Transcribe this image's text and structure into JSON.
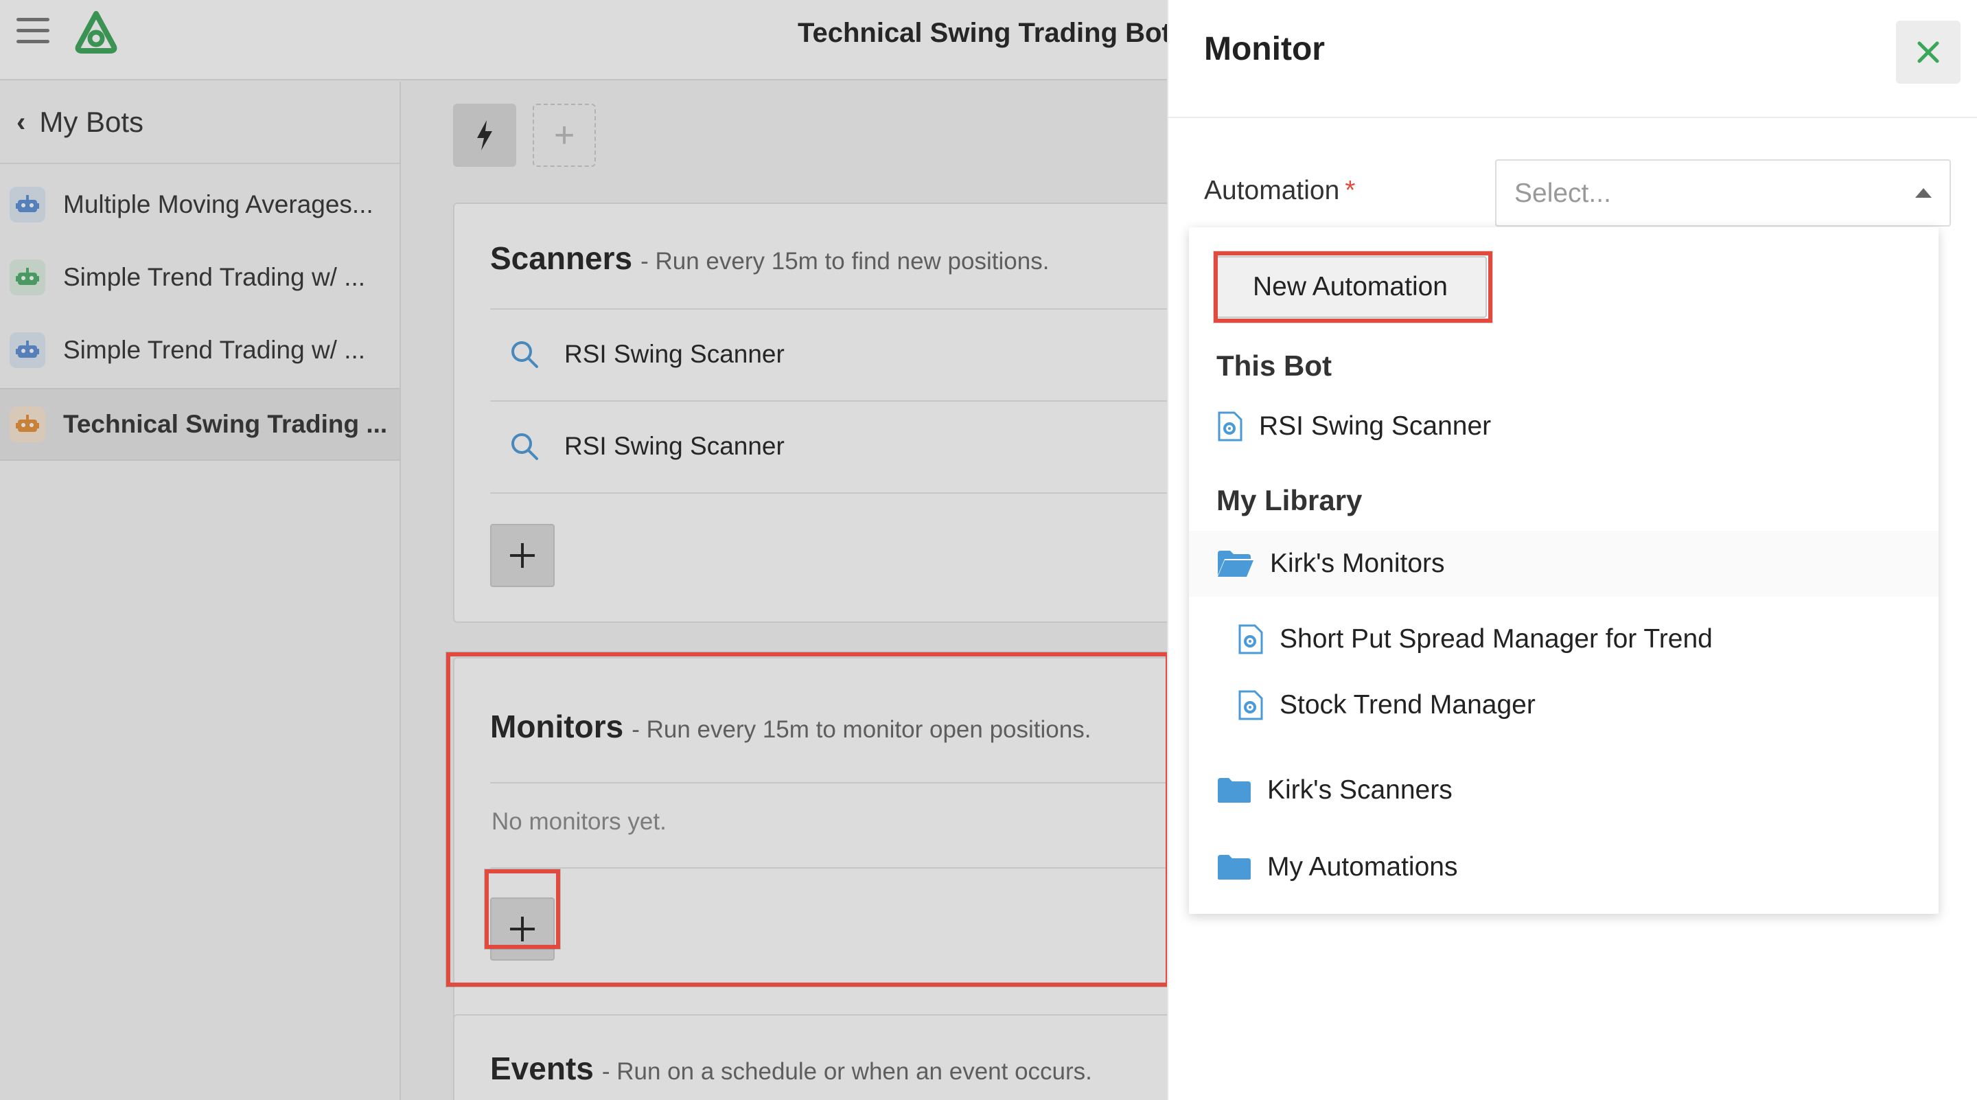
{
  "app": {
    "title": "Technical Swing Trading Bot"
  },
  "sidebar": {
    "back_label": "My Bots",
    "items": [
      {
        "label": "Multiple Moving Averages...",
        "icon": "robot-icon",
        "color": "#5b8fd6",
        "active": false
      },
      {
        "label": "Simple Trend Trading w/ ...",
        "icon": "robot-icon",
        "color": "#4caf6a",
        "active": false
      },
      {
        "label": "Simple Trend Trading w/ ...",
        "icon": "robot-icon",
        "color": "#5b8fd6",
        "active": false
      },
      {
        "label": "Technical Swing Trading ...",
        "icon": "robot-icon",
        "color": "#e8913a",
        "active": true
      }
    ]
  },
  "main": {
    "scanners": {
      "title": "Scanners",
      "subtitle": "- Run every 15m to find new positions.",
      "items": [
        "RSI Swing Scanner",
        "RSI Swing Scanner"
      ]
    },
    "monitors": {
      "title": "Monitors",
      "subtitle": "- Run every 15m to monitor open positions.",
      "empty": "No monitors yet."
    },
    "events": {
      "title": "Events",
      "subtitle": "- Run on a schedule or when an event occurs."
    }
  },
  "drawer": {
    "title": "Monitor",
    "field_label": "Automation",
    "required_mark": "*",
    "select_placeholder": "Select...",
    "dropdown": {
      "new_button": "New Automation",
      "this_bot_header": "This Bot",
      "this_bot_items": [
        "RSI Swing Scanner"
      ],
      "library_header": "My Library",
      "folders": [
        {
          "label": "Kirk's Monitors",
          "open": true,
          "children": [
            "Short Put Spread Manager for Trend",
            "Stock Trend Manager"
          ]
        },
        {
          "label": "Kirk's Scanners",
          "open": false
        },
        {
          "label": "My Automations",
          "open": false
        }
      ]
    }
  },
  "colors": {
    "highlight": "#e04a3f",
    "accent_green": "#3aa657",
    "folder_blue": "#4a9ad8"
  }
}
